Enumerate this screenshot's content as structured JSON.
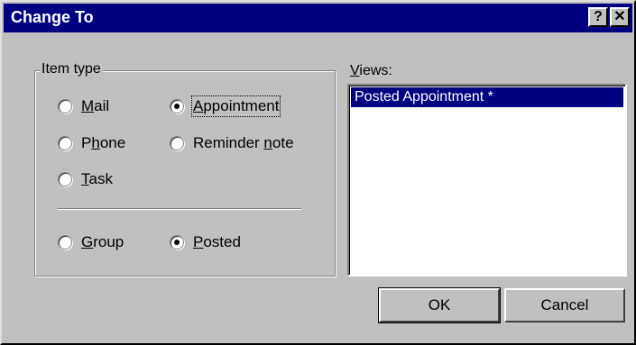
{
  "window": {
    "title": "Change To",
    "help_button": "?",
    "close_button": "✕"
  },
  "item_type": {
    "label": "Item type",
    "options": [
      {
        "pre": "",
        "key": "M",
        "post": "ail",
        "selected": false
      },
      {
        "pre": "",
        "key": "A",
        "post": "ppointment",
        "selected": true
      },
      {
        "pre": "P",
        "key": "h",
        "post": "one",
        "selected": false
      },
      {
        "pre": "Reminder ",
        "key": "n",
        "post": "ote",
        "selected": false
      },
      {
        "pre": "",
        "key": "T",
        "post": "ask",
        "selected": false
      }
    ],
    "mode_options": [
      {
        "pre": "",
        "key": "G",
        "post": "roup",
        "selected": false
      },
      {
        "pre": "",
        "key": "P",
        "post": "osted",
        "selected": true
      }
    ]
  },
  "views": {
    "label_key": "V",
    "label_rest": "iews:",
    "items": [
      "Posted Appointment *"
    ],
    "selected_index": 0
  },
  "buttons": {
    "ok": "OK",
    "cancel": "Cancel"
  }
}
